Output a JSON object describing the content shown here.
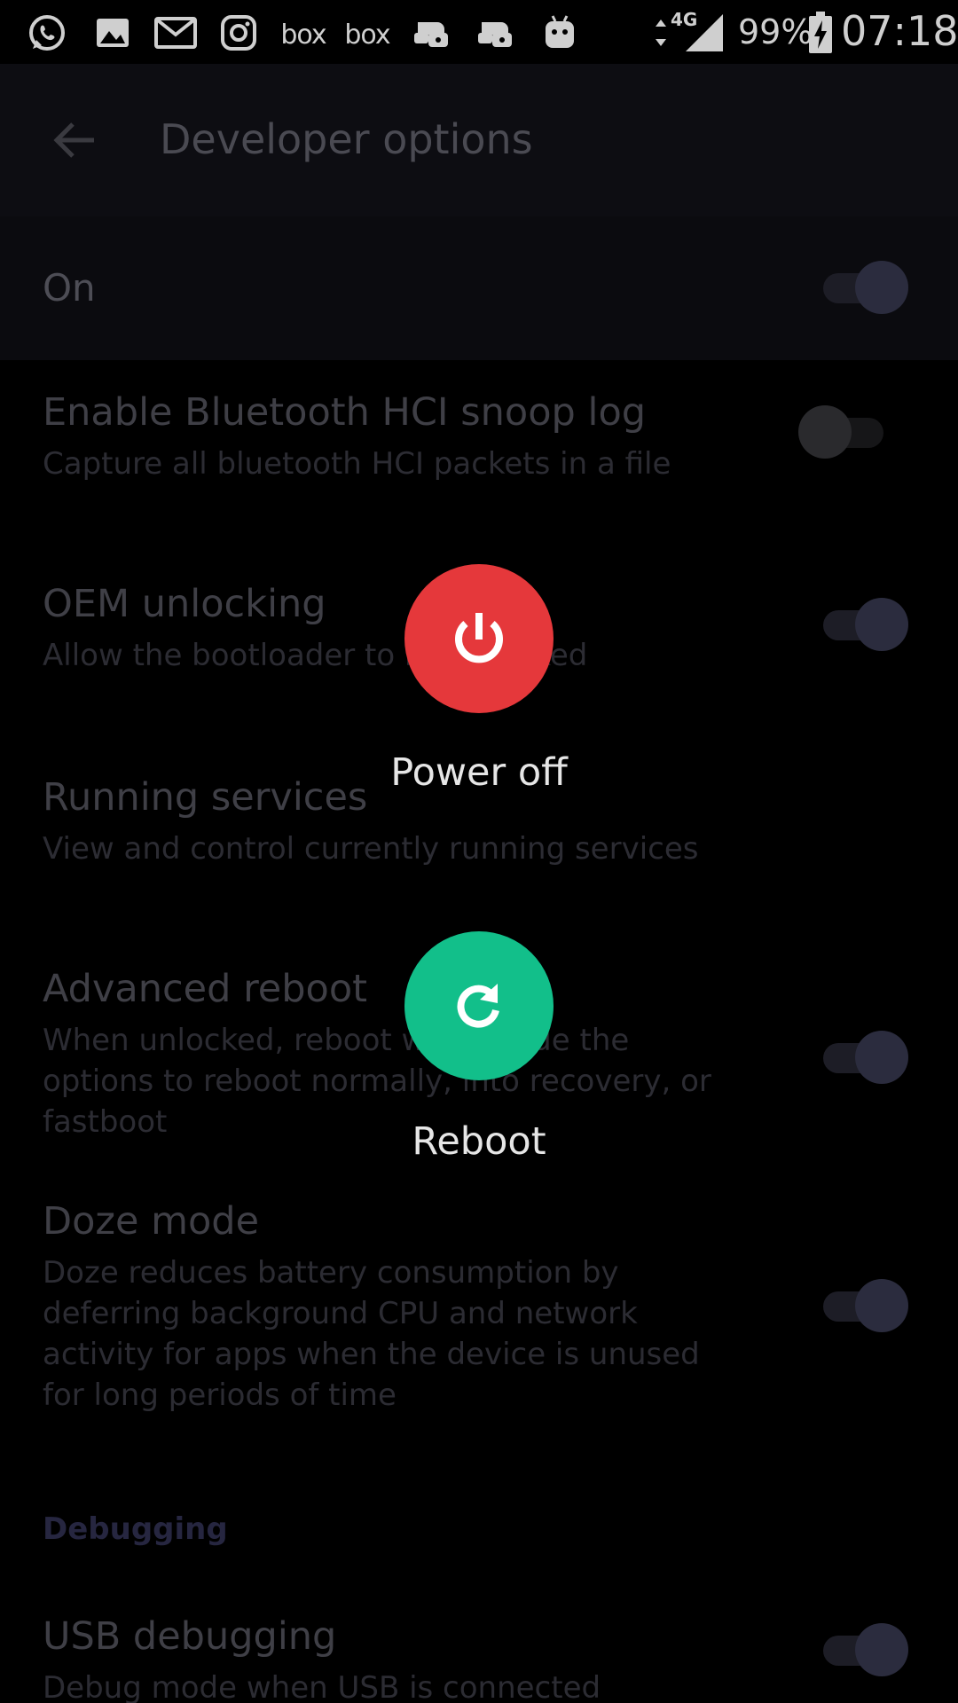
{
  "status_bar": {
    "notification_icons": [
      "whatsapp-icon",
      "gallery-icon",
      "gmail-icon",
      "instagram-icon",
      "box-icon",
      "box-icon",
      "game-controller-icon",
      "game-controller-icon",
      "android-icon"
    ],
    "box_label_1": "box",
    "box_label_2": "box",
    "network_type": "4G",
    "battery_percent": "99%",
    "time": "07:18"
  },
  "app_bar": {
    "title": "Developer options",
    "back_icon": "arrow-back-icon"
  },
  "master_switch": {
    "label": "On",
    "enabled": true
  },
  "settings": [
    {
      "title": "Enable Bluetooth HCI snoop log",
      "summary": "Capture all bluetooth HCI packets in a file",
      "enabled": false
    },
    {
      "title": "OEM unlocking",
      "summary": "Allow the bootloader to be unlocked",
      "enabled": true
    },
    {
      "title": "Running services",
      "summary": "View and control currently running services"
    },
    {
      "title": "Advanced reboot",
      "summary": "When unlocked, reboot will include the options to reboot normally, into recovery, or fastboot",
      "enabled": true
    },
    {
      "title": "Doze mode",
      "summary": "Doze reduces battery consumption by deferring background CPU and network activity for apps when the device is unused for long periods of time",
      "enabled": true
    }
  ],
  "sections": {
    "debugging": {
      "header": "Debugging",
      "items": [
        {
          "title": "USB debugging",
          "summary": "Debug mode when USB is connected",
          "enabled": true
        }
      ]
    }
  },
  "power_menu": {
    "power_off": {
      "label": "Power off",
      "icon": "power-icon",
      "color": "#e5383b"
    },
    "reboot": {
      "label": "Reboot",
      "icon": "reboot-icon",
      "color": "#12bf8a"
    }
  }
}
